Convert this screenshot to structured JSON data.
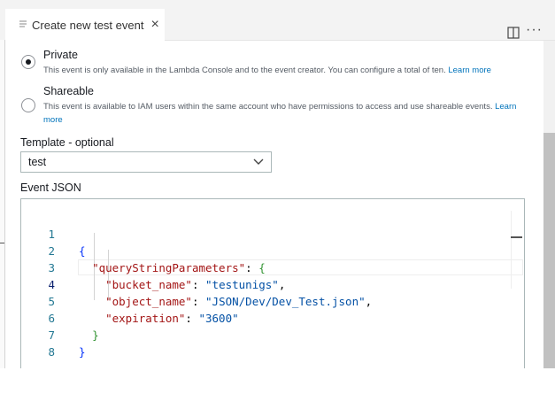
{
  "tab": {
    "title": "Create new test event",
    "close_glyph": "×"
  },
  "toolbar": {
    "more_glyph": "···"
  },
  "sharing": {
    "private": {
      "title": "Private",
      "description": "This event is only available in the Lambda Console and to the event creator. You can configure a total of ten.",
      "learn_more": "Learn more",
      "selected": true
    },
    "shareable": {
      "title": "Shareable",
      "description": "This event is available to IAM users within the same account who have permissions to access and use shareable events.",
      "learn_more": "Learn more",
      "selected": false
    }
  },
  "template": {
    "label": "Template - optional",
    "value": "test"
  },
  "event_json": {
    "label": "Event JSON",
    "active_line": 4,
    "lines": [
      {
        "n": "1"
      },
      {
        "n": "2",
        "key": "\"queryStringParameters\""
      },
      {
        "n": "3",
        "key": "\"bucket_name\"",
        "value": "\"testunigs\""
      },
      {
        "n": "4",
        "key": "\"object_name\"",
        "value": "\"JSON/Dev/Dev_Test.json\""
      },
      {
        "n": "5",
        "key": "\"expiration\"",
        "value": "\"3600\""
      },
      {
        "n": "6"
      },
      {
        "n": "7"
      },
      {
        "n": "8"
      }
    ]
  },
  "icons": [
    "document-icon",
    "close-icon",
    "split-editor-icon",
    "more-actions-icon",
    "chevron-down-icon"
  ]
}
